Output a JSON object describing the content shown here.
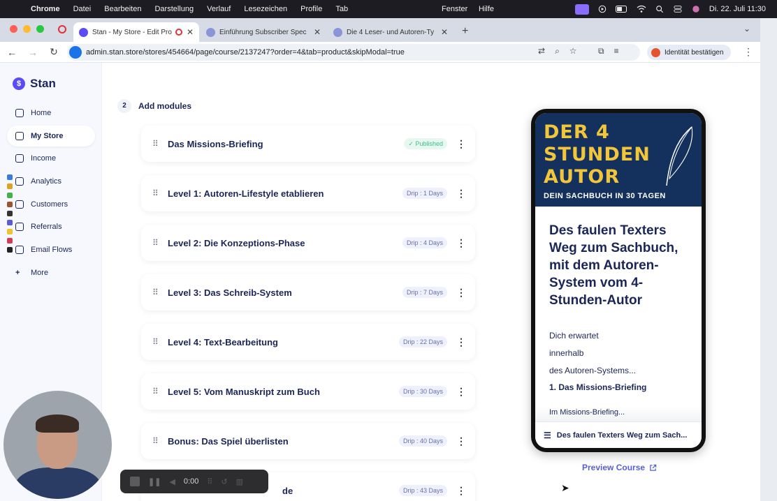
{
  "menubar": {
    "app": "Chrome",
    "items": [
      "Datei",
      "Bearbeiten",
      "Darstellung",
      "Verlauf",
      "Lesezeichen",
      "Profile",
      "Tab"
    ],
    "right_items": [
      "Fenster",
      "Hilfe"
    ],
    "datetime": "Di. 22. Juli  11:30"
  },
  "tabs": [
    {
      "title": "Stan - My Store - Edit Pro",
      "active": true
    },
    {
      "title": "Einführung Subscriber Spec",
      "active": false
    },
    {
      "title": "Die 4 Leser- und Autoren-Ty",
      "active": false
    }
  ],
  "toolbar": {
    "url": "admin.stan.store/stores/454664/page/course/2137247?order=4&tab=product&skipModal=true",
    "identity_label": "Identität bestätigen"
  },
  "sidebar": {
    "brand": "Stan",
    "items": [
      {
        "label": "Home",
        "icon": "home-icon",
        "active": false
      },
      {
        "label": "My Store",
        "icon": "store-icon",
        "active": true
      },
      {
        "label": "Income",
        "icon": "income-icon",
        "active": false
      },
      {
        "label": "Analytics",
        "icon": "analytics-icon",
        "active": false
      },
      {
        "label": "Customers",
        "icon": "customers-icon",
        "active": false
      },
      {
        "label": "Referrals",
        "icon": "referrals-icon",
        "active": false
      },
      {
        "label": "Email Flows",
        "icon": "email-icon",
        "active": false
      },
      {
        "label": "More",
        "icon": "plus-icon",
        "active": false
      }
    ]
  },
  "step": {
    "number": "2",
    "title": "Add modules"
  },
  "modules": [
    {
      "title": "Das Missions-Briefing",
      "badge": "✓ Published",
      "badge_type": "published"
    },
    {
      "title": "Level 1: Autoren-Lifestyle etablieren",
      "badge": "Drip : 1 Days",
      "badge_type": "drip"
    },
    {
      "title": "Level 2: Die Konzeptions-Phase",
      "badge": "Drip : 4 Days",
      "badge_type": "drip"
    },
    {
      "title": "Level 3: Das Schreib-System",
      "badge": "Drip : 7 Days",
      "badge_type": "drip"
    },
    {
      "title": "Level 4: Text-Bearbeitung",
      "badge": "Drip : 22 Days",
      "badge_type": "drip"
    },
    {
      "title": "Level 5: Vom Manuskript zum Buch",
      "badge": "Drip : 30 Days",
      "badge_type": "drip"
    },
    {
      "title": "Bonus: Das Spiel überlisten",
      "badge": "Drip : 40 Days",
      "badge_type": "drip"
    },
    {
      "title": "de",
      "badge": "Drip : 43 Days",
      "badge_type": "drip"
    }
  ],
  "preview": {
    "cover_line1": "DER 4",
    "cover_line2": "STUNDEN",
    "cover_line3": "AUTOR",
    "cover_sub": "DEIN SACHBUCH IN 30 TAGEN",
    "course_title": "Des faulen Texters Weg zum Sachbuch, mit dem Autoren-System vom 4-Stunden-Autor",
    "lines": [
      "Dich erwartet",
      "innerhalb",
      "des Autoren-Systems...",
      "1. Das Missions-Briefing",
      "Im Missions-Briefing..."
    ],
    "bottom_bar": "Des faulen Texters Weg zum Sach...",
    "preview_link": "Preview Course"
  },
  "recorder": {
    "time": "0:00"
  },
  "colors": {
    "accent": "#5b4bf5",
    "navy": "#1b2656",
    "published": "#3cc08c",
    "cover_bg": "#14305c",
    "cover_gold": "#f2c63a"
  }
}
